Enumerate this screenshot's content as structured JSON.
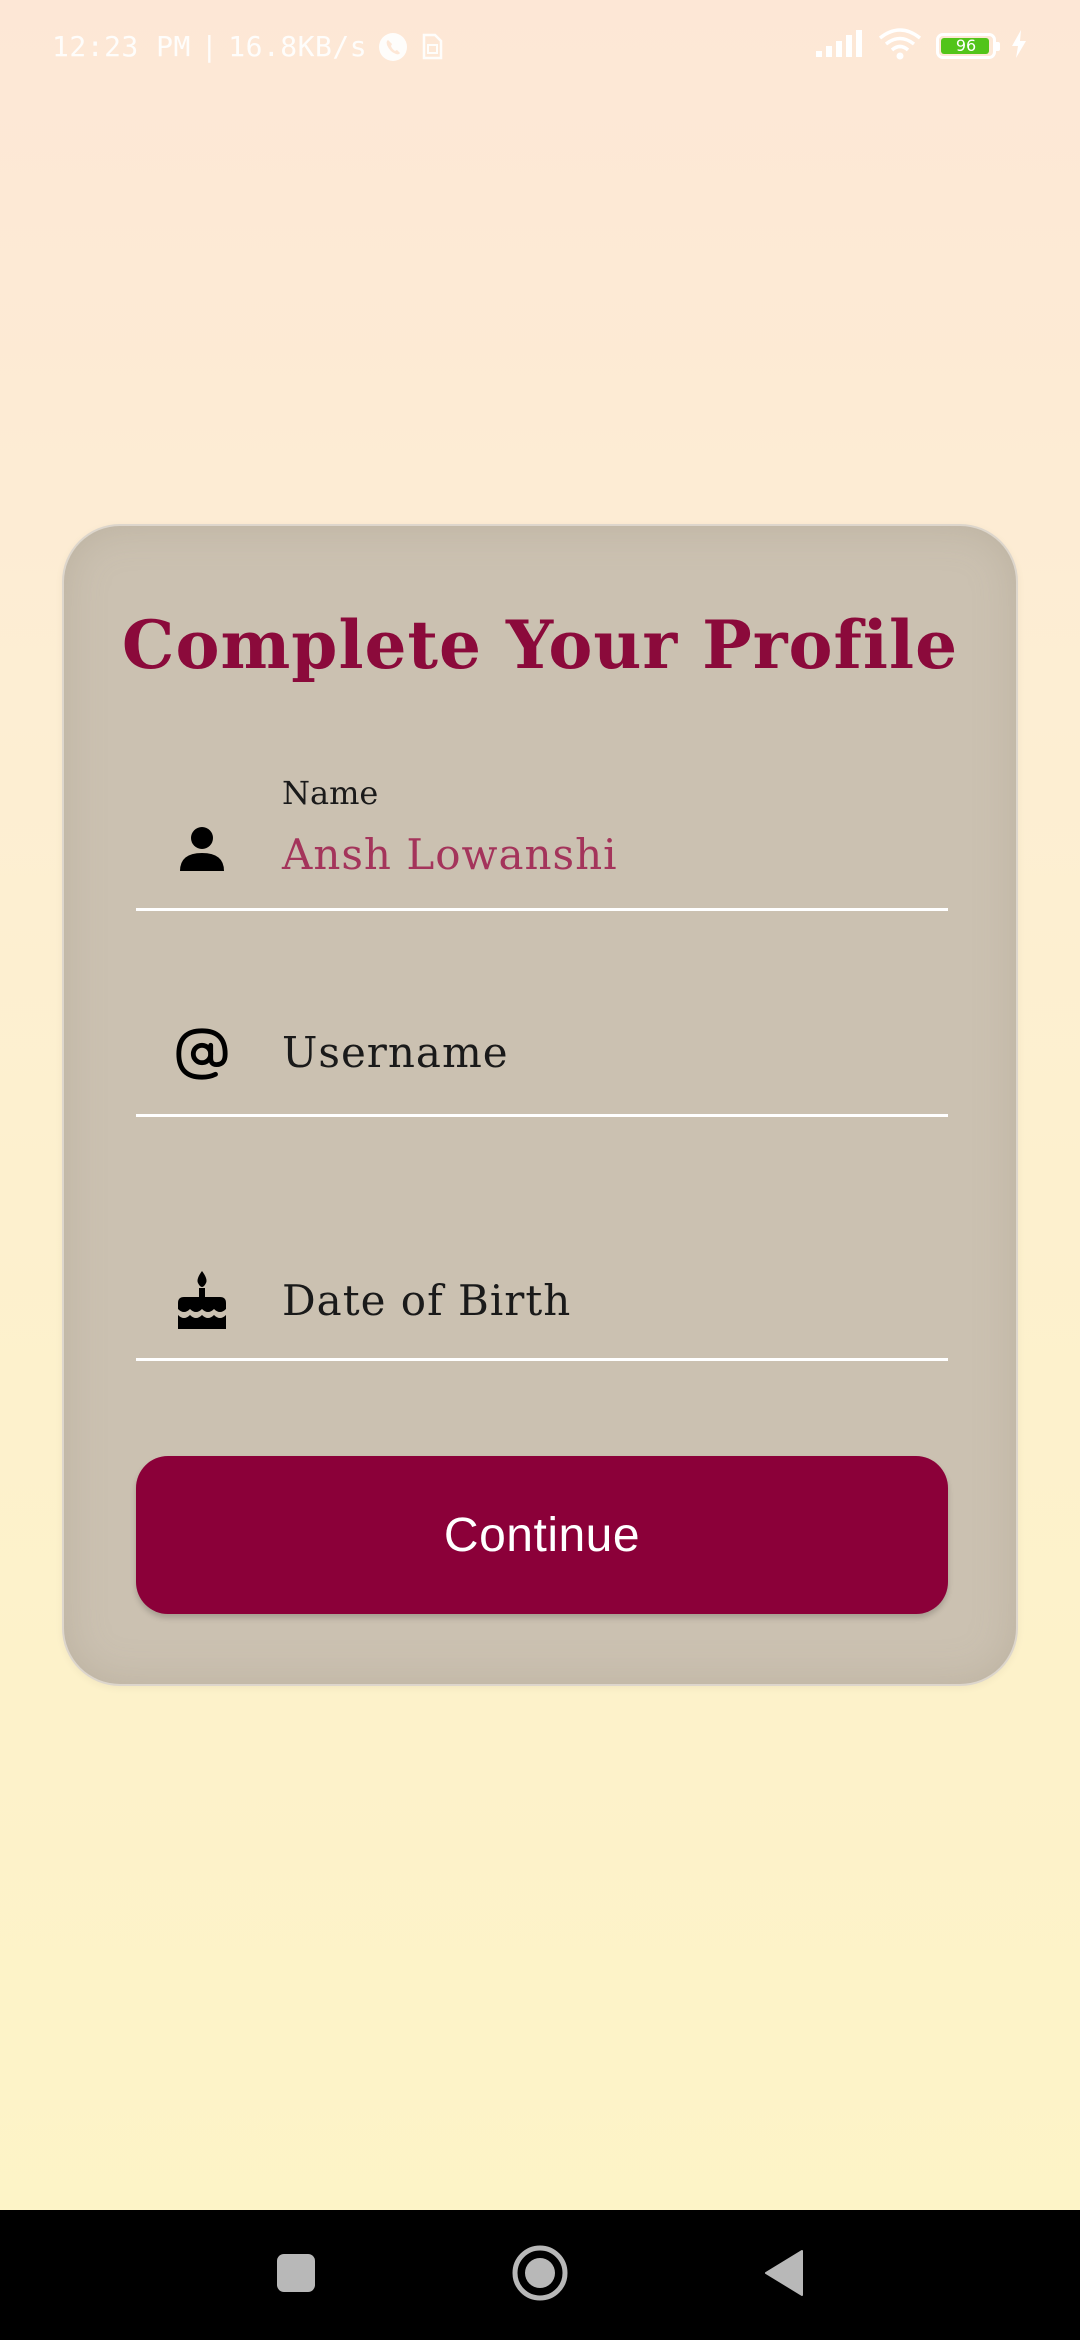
{
  "status_bar": {
    "time": "12:23 PM",
    "separator": "|",
    "network_speed": "16.8KB/s",
    "battery_level": "96",
    "battery_fraction": 0.96,
    "icons": [
      "phone-call-icon",
      "sim-icon",
      "signal-bars-icon",
      "wifi-icon",
      "battery-icon",
      "charging-bolt-icon"
    ]
  },
  "card": {
    "title": "Complete Your Profile",
    "fields": {
      "name": {
        "label": "Name",
        "value": "Ansh Lowanshi",
        "icon": "person-icon"
      },
      "username": {
        "placeholder": "Username",
        "icon": "at-sign-icon"
      },
      "dob": {
        "placeholder": "Date of Birth",
        "icon": "birthday-cake-icon"
      }
    },
    "continue_label": "Continue"
  },
  "nav_bar": {
    "buttons": [
      "recents-square-icon",
      "home-circle-icon",
      "back-triangle-icon"
    ]
  },
  "colors": {
    "accent": "#8b0039",
    "title": "#8b0a3b",
    "name_value": "#a4345b",
    "card_background": "#cbc1b1",
    "page_gradient_top": "#fde7d6",
    "page_gradient_bottom": "#fdf4c6"
  }
}
